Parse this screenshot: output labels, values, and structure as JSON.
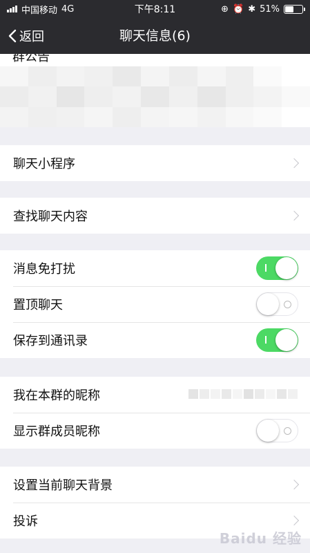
{
  "status_bar": {
    "carrier": "中国移动",
    "network": "4G",
    "time": "下午8:11",
    "battery": "51%",
    "battery_level": 0.51
  },
  "nav": {
    "back_label": "返回",
    "title": "聊天信息(6)"
  },
  "notice": {
    "label": "群公告"
  },
  "rows": {
    "mini_programs": "聊天小程序",
    "search_history": "查找聊天内容",
    "mute": "消息免打扰",
    "pin": "置顶聊天",
    "save_contacts": "保存到通讯录",
    "my_nickname": "我在本群的昵称",
    "show_nicknames": "显示群成员昵称",
    "background": "设置当前聊天背景",
    "complain": "投诉"
  },
  "toggles": {
    "mute": true,
    "pin": false,
    "save_contacts": true,
    "show_nicknames": false
  },
  "colors": {
    "toggle_on": "#4cd964",
    "nav_bg": "#2b2b2f",
    "page_bg": "#efeff4"
  },
  "watermark": "Baidu 经验"
}
